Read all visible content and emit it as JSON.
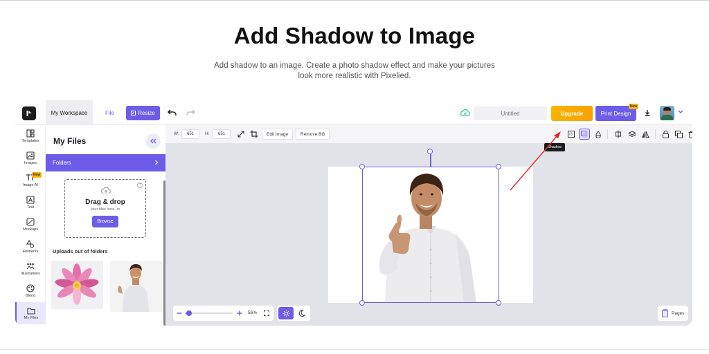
{
  "hero": {
    "title": "Add Shadow to Image",
    "subtitle": "Add shadow to an image. Create a photo shadow effect and make your pictures look more realistic with Pixelied."
  },
  "topbar": {
    "workspace": "My Workspace",
    "file": "File",
    "resize": "Resize",
    "doc_title": "Untitled",
    "upgrade": "Upgrade",
    "print": "Print Design",
    "print_badge": "New"
  },
  "sidebar": {
    "items": [
      {
        "label": "Templates",
        "icon": "templates-icon"
      },
      {
        "label": "Images",
        "icon": "image-icon"
      },
      {
        "label": "Image AI",
        "icon": "image-ai-icon",
        "badge": "New"
      },
      {
        "label": "Text",
        "icon": "text-icon"
      },
      {
        "label": "Mockups",
        "icon": "mockups-icon"
      },
      {
        "label": "Elements",
        "icon": "elements-icon"
      },
      {
        "label": "Illustrations",
        "icon": "illustrations-icon"
      },
      {
        "label": "Blend",
        "icon": "blend-icon"
      },
      {
        "label": "My Files",
        "icon": "folder-icon",
        "active": true
      }
    ]
  },
  "files_panel": {
    "title": "My Files",
    "folders": "Folders",
    "drop_title": "Drag & drop",
    "drop_sub": "your files here, or",
    "browse": "Browse",
    "uploads_title": "Uploads out of folders"
  },
  "toolbar": {
    "w_label": "W:",
    "w_value": "651",
    "h_label": "H:",
    "h_value": "651",
    "edit_image": "Edit Image",
    "remove_bg": "Remove BG",
    "tooltip": "Shadow"
  },
  "zoom": {
    "value": "56%",
    "level": 0.56
  },
  "pages": "Pages",
  "colors": {
    "accent": "#6c5ce7",
    "upgrade": "#f7b500",
    "arrow": "#e0242a"
  }
}
